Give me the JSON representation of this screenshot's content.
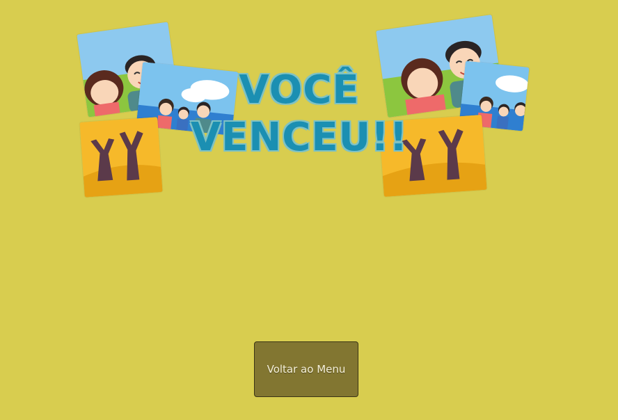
{
  "title": {
    "line1": "VOCÊ",
    "line2": "VENCEU!!"
  },
  "menu_button": {
    "label": "Voltar ao Menu"
  },
  "colors": {
    "background": "#d8cd4f",
    "title": "#1b8fb2",
    "button": "#827631"
  },
  "images": [
    "couple-illustration",
    "family-beach-illustration",
    "celebration-silhouette-illustration"
  ]
}
